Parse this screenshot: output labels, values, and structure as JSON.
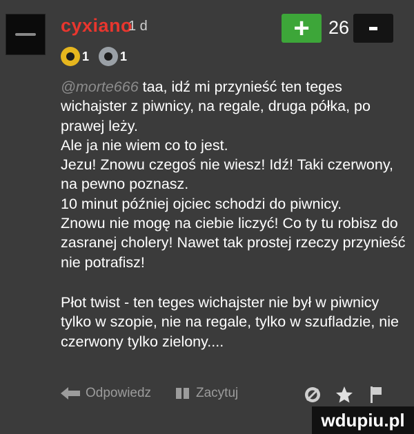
{
  "comment": {
    "username": "cyxiano",
    "age": "1 d",
    "score": "26",
    "vote_plus_label": "+",
    "badges": [
      {
        "icon": "gold-medal-icon",
        "count": "1",
        "color": "#e6b61e"
      },
      {
        "icon": "silver-medal-icon",
        "count": "1",
        "color": "#9aa0a6"
      }
    ],
    "mention": "@morte666",
    "lines": [
      "taa, idź mi przynieść ten teges wichajster z piwnicy, na regale, druga półka, po prawej leży.",
      "Ale ja nie wiem co to jest.",
      "Jezu! Znowu czegoś nie wiesz! Idź! Taki czerwony, na pewno poznasz.",
      "10 minut później ojciec schodzi do piwnicy.",
      "Znowu nie mogę na ciebie liczyć! Co ty tu robisz do zasranej cholery! Nawet tak prostej rzeczy przynieść nie potrafisz!"
    ],
    "twist": "Płot twist - ten teges wichajster nie był w piwnicy tylko w szopie, nie na regale, tylko w szufladzie, nie czerwony tylko zielony...."
  },
  "actions": {
    "reply_label": "Odpowiedz",
    "quote_label": "Zacytuj"
  },
  "watermark": "wdupiu.pl",
  "colors": {
    "background": "#3b3b3b",
    "username": "#e8362e",
    "plus": "#3da639",
    "minus": "#141414",
    "muted": "#9c9c9c"
  }
}
